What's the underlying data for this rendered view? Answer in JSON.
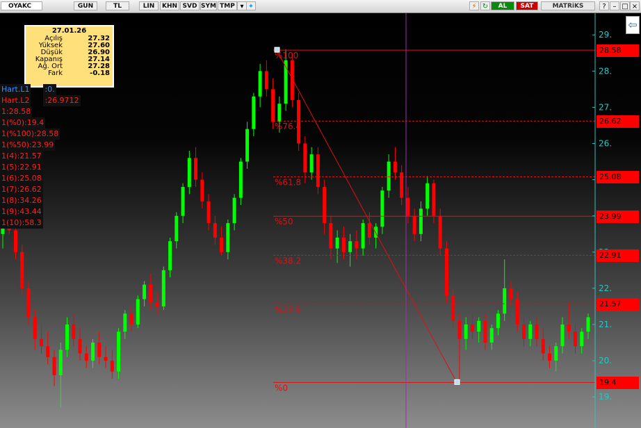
{
  "toolbar": {
    "symbol": "OYAKC",
    "periods": [
      "GUN",
      "TL",
      "LIN",
      "KHN",
      "SVD",
      "SYM",
      "TMP"
    ],
    "buy_label": "AL",
    "sell_label": "SAT",
    "brand": "MATRiKS"
  },
  "info": {
    "date": "27.01.26",
    "rows": [
      {
        "label": "Açılış",
        "value": "27.32"
      },
      {
        "label": "Yüksek",
        "value": "27.60"
      },
      {
        "label": "Düşük",
        "value": "26.90"
      },
      {
        "label": "Kapanış",
        "value": "27.14"
      },
      {
        "label": "Ağ. Ort",
        "value": "27.28"
      },
      {
        "label": "Fark",
        "value": "-0.18"
      }
    ]
  },
  "left_list": [
    {
      "text": "Hart.L1",
      "value": ":0.",
      "color": "#3a8cff"
    },
    {
      "text": "Hart.L2",
      "value": ":26.9712",
      "color": "#ff2020"
    },
    {
      "text": "1:28.58",
      "value": "",
      "color": "#ff2020"
    },
    {
      "text": "1(%0):19.4",
      "value": "",
      "color": "#ff2020"
    },
    {
      "text": "1(%100):28.58",
      "value": "",
      "color": "#ff2020"
    },
    {
      "text": "1(%50):23.99",
      "value": "",
      "color": "#ff2020"
    },
    {
      "text": "1(4):21.57",
      "value": "",
      "color": "#ff2020"
    },
    {
      "text": "1(5):22.91",
      "value": "",
      "color": "#ff2020"
    },
    {
      "text": "1(6):25.08",
      "value": "",
      "color": "#ff2020"
    },
    {
      "text": "1(7):26.62",
      "value": "",
      "color": "#ff2020"
    },
    {
      "text": "1(8):34.26",
      "value": "",
      "color": "#ff2020"
    },
    {
      "text": "1(9):43.44",
      "value": "",
      "color": "#ff2020"
    },
    {
      "text": "1(10):58.3",
      "value": "",
      "color": "#ff2020"
    }
  ],
  "chart_data": {
    "type": "candlestick",
    "y_ticks": [
      19,
      20,
      21,
      22,
      23,
      24,
      25,
      26,
      27,
      28,
      29
    ],
    "y_tick_labels": [
      "19.",
      "20.",
      "21.",
      "22.",
      "23",
      "24",
      "25.",
      "26.",
      "27.",
      "28.",
      "29."
    ],
    "ylim": [
      18.85,
      29.35
    ],
    "up_color": "#00ff00",
    "down_color": "#ff0000",
    "fib_levels": [
      {
        "label": "%100",
        "value": 28.58,
        "line": "solid",
        "box": "28.58"
      },
      {
        "label": "%76.4",
        "value": 26.62,
        "line": "dashed",
        "box": "26.62"
      },
      {
        "label": "%61.8",
        "value": 25.08,
        "line": "dashed",
        "box": "25.08"
      },
      {
        "label": "%50",
        "value": 23.99,
        "line": "solid",
        "box": "23.99"
      },
      {
        "label": "%38.2",
        "value": 22.91,
        "line": "dashed",
        "box": "22.91"
      },
      {
        "label": "%23.6",
        "value": 21.57,
        "line": "dashed",
        "box": "21.57"
      },
      {
        "label": "%0",
        "value": 19.4,
        "line": "solid",
        "box": "19.4"
      }
    ],
    "fib_start": {
      "high": 28.58,
      "low": 19.4
    },
    "candles": [
      {
        "o": 23.5,
        "h": 24.0,
        "l": 23.1,
        "c": 23.8
      },
      {
        "o": 23.8,
        "h": 24.3,
        "l": 23.5,
        "c": 23.6
      },
      {
        "o": 23.6,
        "h": 23.9,
        "l": 22.8,
        "c": 23.0
      },
      {
        "o": 23.0,
        "h": 23.2,
        "l": 21.8,
        "c": 22.0
      },
      {
        "o": 22.0,
        "h": 22.2,
        "l": 21.0,
        "c": 21.2
      },
      {
        "o": 21.2,
        "h": 21.4,
        "l": 20.3,
        "c": 20.6
      },
      {
        "o": 20.6,
        "h": 21.0,
        "l": 20.2,
        "c": 20.4
      },
      {
        "o": 20.4,
        "h": 20.8,
        "l": 19.9,
        "c": 20.1
      },
      {
        "o": 20.1,
        "h": 20.3,
        "l": 19.3,
        "c": 19.6
      },
      {
        "o": 19.6,
        "h": 20.5,
        "l": 18.7,
        "c": 20.3
      },
      {
        "o": 20.3,
        "h": 21.2,
        "l": 20.1,
        "c": 21.0
      },
      {
        "o": 21.0,
        "h": 21.3,
        "l": 20.4,
        "c": 20.6
      },
      {
        "o": 20.6,
        "h": 20.9,
        "l": 20.0,
        "c": 20.2
      },
      {
        "o": 20.2,
        "h": 20.4,
        "l": 19.8,
        "c": 20.0
      },
      {
        "o": 20.0,
        "h": 20.6,
        "l": 19.8,
        "c": 20.5
      },
      {
        "o": 20.5,
        "h": 20.8,
        "l": 19.9,
        "c": 20.1
      },
      {
        "o": 20.1,
        "h": 20.4,
        "l": 19.8,
        "c": 20.0
      },
      {
        "o": 20.0,
        "h": 20.3,
        "l": 19.5,
        "c": 19.7
      },
      {
        "o": 19.7,
        "h": 20.9,
        "l": 19.5,
        "c": 20.8
      },
      {
        "o": 20.8,
        "h": 21.4,
        "l": 20.6,
        "c": 21.3
      },
      {
        "o": 21.3,
        "h": 21.5,
        "l": 20.8,
        "c": 21.0
      },
      {
        "o": 21.0,
        "h": 21.8,
        "l": 20.9,
        "c": 21.7
      },
      {
        "o": 21.7,
        "h": 22.2,
        "l": 21.5,
        "c": 22.1
      },
      {
        "o": 22.1,
        "h": 22.4,
        "l": 21.4,
        "c": 21.6
      },
      {
        "o": 21.6,
        "h": 21.9,
        "l": 21.3,
        "c": 21.5
      },
      {
        "o": 21.5,
        "h": 22.6,
        "l": 21.4,
        "c": 22.5
      },
      {
        "o": 22.5,
        "h": 23.4,
        "l": 22.3,
        "c": 23.3
      },
      {
        "o": 23.3,
        "h": 24.1,
        "l": 23.1,
        "c": 24.0
      },
      {
        "o": 24.0,
        "h": 24.9,
        "l": 23.8,
        "c": 24.8
      },
      {
        "o": 24.8,
        "h": 25.8,
        "l": 24.6,
        "c": 25.6
      },
      {
        "o": 25.6,
        "h": 25.9,
        "l": 24.8,
        "c": 25.0
      },
      {
        "o": 25.0,
        "h": 25.2,
        "l": 24.2,
        "c": 24.4
      },
      {
        "o": 24.4,
        "h": 24.6,
        "l": 23.6,
        "c": 23.8
      },
      {
        "o": 23.8,
        "h": 24.0,
        "l": 23.2,
        "c": 23.4
      },
      {
        "o": 23.4,
        "h": 23.7,
        "l": 22.9,
        "c": 23.0
      },
      {
        "o": 23.0,
        "h": 23.9,
        "l": 22.8,
        "c": 23.8
      },
      {
        "o": 23.8,
        "h": 24.6,
        "l": 23.6,
        "c": 24.5
      },
      {
        "o": 24.5,
        "h": 25.6,
        "l": 24.3,
        "c": 25.5
      },
      {
        "o": 25.5,
        "h": 26.6,
        "l": 25.3,
        "c": 26.4
      },
      {
        "o": 26.4,
        "h": 27.4,
        "l": 26.2,
        "c": 27.3
      },
      {
        "o": 27.3,
        "h": 28.2,
        "l": 27.0,
        "c": 28.0
      },
      {
        "o": 28.0,
        "h": 28.3,
        "l": 27.3,
        "c": 27.5
      },
      {
        "o": 27.5,
        "h": 27.8,
        "l": 26.4,
        "c": 26.6
      },
      {
        "o": 26.6,
        "h": 27.3,
        "l": 26.3,
        "c": 27.1
      },
      {
        "o": 27.1,
        "h": 28.6,
        "l": 26.9,
        "c": 28.3
      },
      {
        "o": 28.3,
        "h": 28.5,
        "l": 27.0,
        "c": 27.2
      },
      {
        "o": 27.2,
        "h": 27.4,
        "l": 25.8,
        "c": 26.0
      },
      {
        "o": 26.0,
        "h": 26.2,
        "l": 24.9,
        "c": 25.2
      },
      {
        "o": 25.2,
        "h": 25.9,
        "l": 25.0,
        "c": 25.7
      },
      {
        "o": 25.7,
        "h": 25.9,
        "l": 24.6,
        "c": 24.8
      },
      {
        "o": 24.8,
        "h": 25.0,
        "l": 23.5,
        "c": 23.8
      },
      {
        "o": 23.8,
        "h": 24.0,
        "l": 22.8,
        "c": 23.1
      },
      {
        "o": 23.1,
        "h": 23.6,
        "l": 22.7,
        "c": 23.4
      },
      {
        "o": 23.4,
        "h": 23.7,
        "l": 22.8,
        "c": 23.0
      },
      {
        "o": 23.0,
        "h": 23.5,
        "l": 22.6,
        "c": 23.3
      },
      {
        "o": 23.3,
        "h": 23.6,
        "l": 22.8,
        "c": 23.1
      },
      {
        "o": 23.1,
        "h": 23.9,
        "l": 22.9,
        "c": 23.8
      },
      {
        "o": 23.8,
        "h": 24.1,
        "l": 23.2,
        "c": 23.4
      },
      {
        "o": 23.4,
        "h": 23.8,
        "l": 23.1,
        "c": 23.7
      },
      {
        "o": 23.7,
        "h": 24.8,
        "l": 23.5,
        "c": 24.7
      },
      {
        "o": 24.7,
        "h": 25.7,
        "l": 24.5,
        "c": 25.5
      },
      {
        "o": 25.5,
        "h": 25.9,
        "l": 25.0,
        "c": 25.2
      },
      {
        "o": 25.2,
        "h": 25.4,
        "l": 24.3,
        "c": 24.5
      },
      {
        "o": 24.5,
        "h": 24.8,
        "l": 23.8,
        "c": 24.0
      },
      {
        "o": 24.0,
        "h": 24.2,
        "l": 23.3,
        "c": 23.5
      },
      {
        "o": 23.5,
        "h": 24.4,
        "l": 23.3,
        "c": 24.2
      },
      {
        "o": 24.2,
        "h": 25.1,
        "l": 24.0,
        "c": 24.9
      },
      {
        "o": 24.9,
        "h": 25.0,
        "l": 23.8,
        "c": 24.0
      },
      {
        "o": 24.0,
        "h": 24.2,
        "l": 22.9,
        "c": 23.1
      },
      {
        "o": 23.1,
        "h": 23.3,
        "l": 21.6,
        "c": 21.8
      },
      {
        "o": 21.8,
        "h": 22.0,
        "l": 20.9,
        "c": 21.1
      },
      {
        "o": 21.1,
        "h": 21.3,
        "l": 19.4,
        "c": 20.6
      },
      {
        "o": 20.6,
        "h": 21.2,
        "l": 20.3,
        "c": 21.0
      },
      {
        "o": 21.0,
        "h": 21.3,
        "l": 20.6,
        "c": 20.8
      },
      {
        "o": 20.8,
        "h": 21.2,
        "l": 20.5,
        "c": 21.1
      },
      {
        "o": 21.1,
        "h": 21.3,
        "l": 20.3,
        "c": 20.5
      },
      {
        "o": 20.5,
        "h": 21.0,
        "l": 20.3,
        "c": 20.9
      },
      {
        "o": 20.9,
        "h": 21.4,
        "l": 20.7,
        "c": 21.3
      },
      {
        "o": 21.3,
        "h": 22.8,
        "l": 21.1,
        "c": 22.0
      },
      {
        "o": 22.0,
        "h": 22.2,
        "l": 21.5,
        "c": 21.7
      },
      {
        "o": 21.7,
        "h": 21.9,
        "l": 20.8,
        "c": 21.0
      },
      {
        "o": 21.0,
        "h": 21.2,
        "l": 20.4,
        "c": 20.6
      },
      {
        "o": 20.6,
        "h": 21.1,
        "l": 20.4,
        "c": 21.0
      },
      {
        "o": 21.0,
        "h": 21.2,
        "l": 20.4,
        "c": 20.6
      },
      {
        "o": 20.6,
        "h": 20.9,
        "l": 20.0,
        "c": 20.2
      },
      {
        "o": 20.2,
        "h": 20.4,
        "l": 19.8,
        "c": 20.0
      },
      {
        "o": 20.0,
        "h": 20.5,
        "l": 19.7,
        "c": 20.4
      },
      {
        "o": 20.4,
        "h": 21.2,
        "l": 20.2,
        "c": 21.0
      },
      {
        "o": 21.0,
        "h": 21.6,
        "l": 20.6,
        "c": 20.8
      },
      {
        "o": 20.8,
        "h": 21.0,
        "l": 20.2,
        "c": 20.4
      },
      {
        "o": 20.4,
        "h": 20.9,
        "l": 20.2,
        "c": 20.8
      },
      {
        "o": 20.8,
        "h": 21.3,
        "l": 20.6,
        "c": 21.2
      }
    ]
  }
}
